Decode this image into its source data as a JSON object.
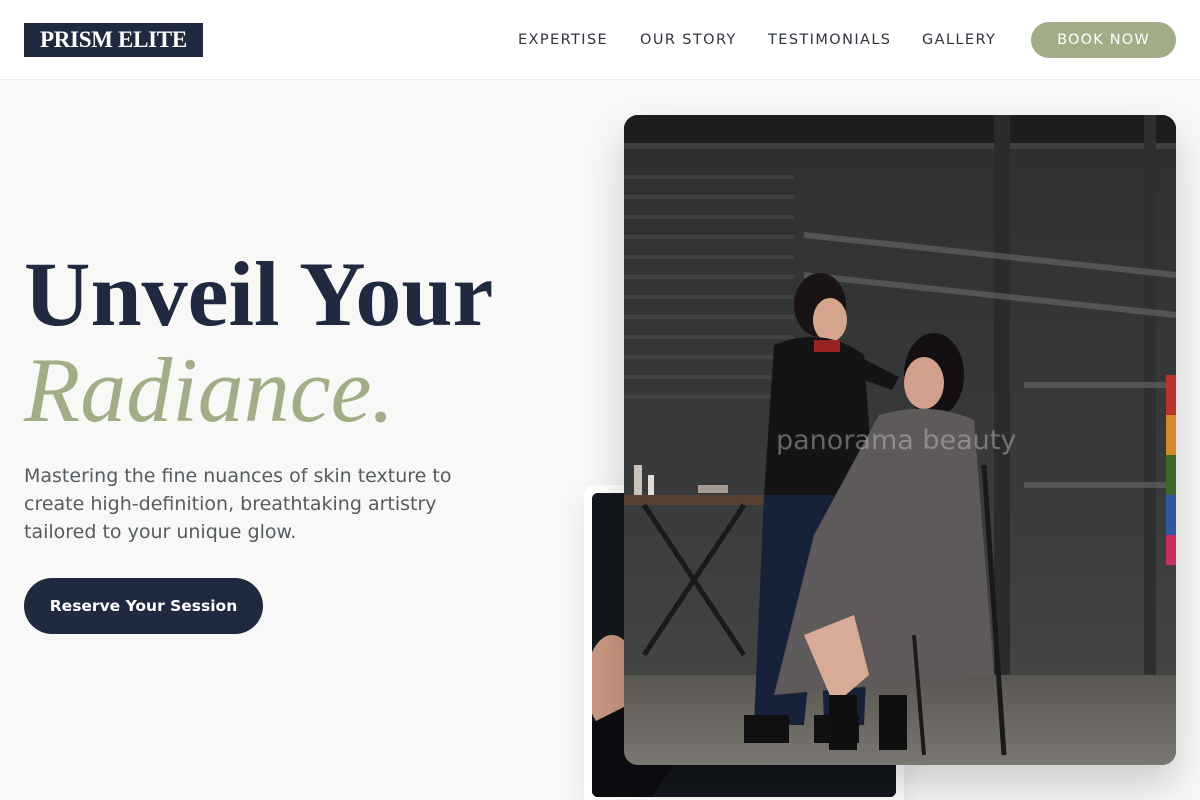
{
  "header": {
    "logo": "PRISM ELITE",
    "nav": [
      "EXPERTISE",
      "OUR STORY",
      "TESTIMONIALS",
      "GALLERY"
    ],
    "book_label": "BOOK NOW"
  },
  "hero": {
    "headline_line1": "Unveil Your",
    "headline_line2": "Radiance.",
    "subtext": "Mastering the fine nuances of skin texture to create high-definition, breathtaking artistry tailored to your unique glow.",
    "cta_label": "Reserve Your Session"
  },
  "images": {
    "main_watermark": "panorama beauty"
  },
  "colors": {
    "navy": "#1f2a40",
    "sage": "#a1ad86",
    "background": "#f8f8f6"
  }
}
